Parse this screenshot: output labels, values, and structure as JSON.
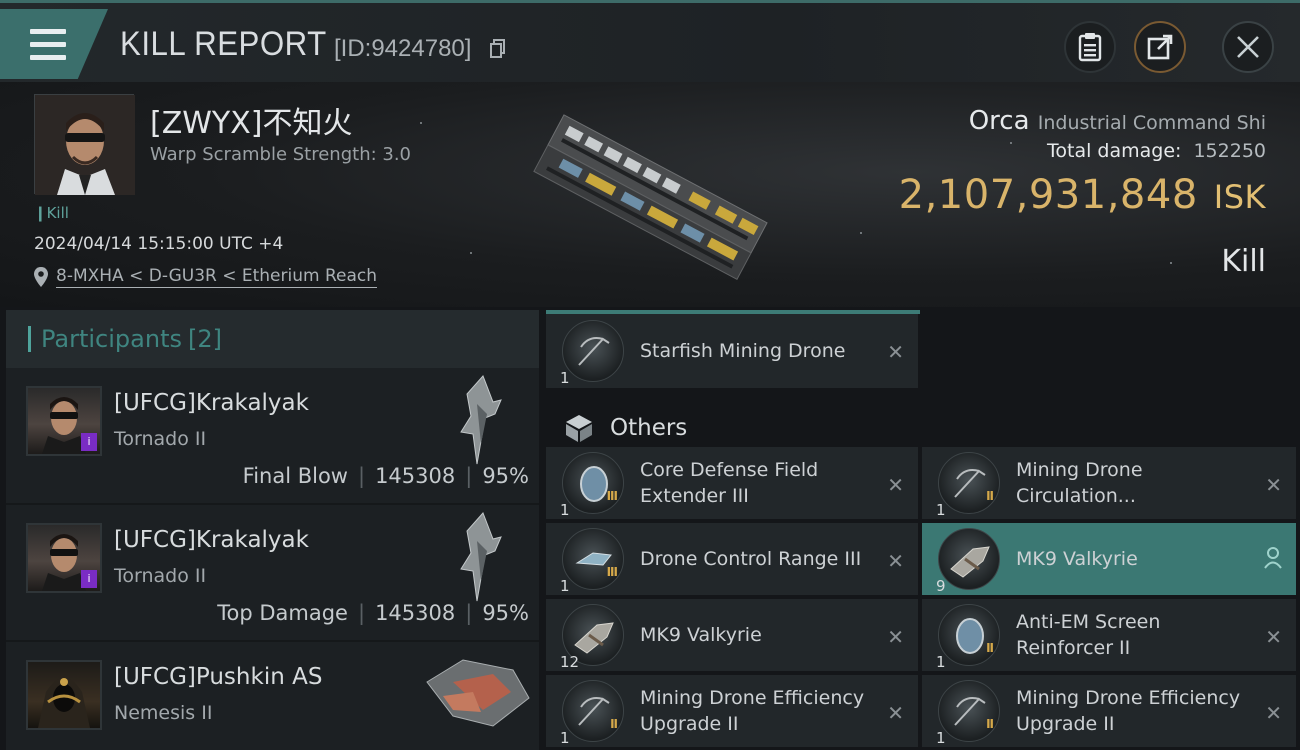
{
  "header": {
    "title": "KILL REPORT",
    "report_id": "[ID:9424780]",
    "buttons": {
      "notes": "clipboard-icon",
      "share": "external-link-icon",
      "close": "close-icon"
    }
  },
  "victim": {
    "name": "[ZWYX]不知火",
    "subtitle": "Warp Scramble Strength: 3.0",
    "kill_tag": "Kill",
    "datetime": "2024/04/14 15:15:00 UTC +4",
    "location": "8-MXHA < D-GU3R < Etherium Reach",
    "ship_name": "Orca",
    "ship_class": "Industrial Command Shi",
    "total_damage_label": "Total damage:",
    "total_damage": "152250",
    "isk_value": "2,107,931,848",
    "isk_unit": "ISK",
    "result": "Kill"
  },
  "participants": {
    "label": "Participants",
    "count": "[2]",
    "rows": [
      {
        "name": "[UFCG]Krakalyak",
        "ship": "Tornado II",
        "role": "Final Blow",
        "damage": "145308",
        "percent": "95%"
      },
      {
        "name": "[UFCG]Krakalyak",
        "ship": "Tornado II",
        "role": "Top Damage",
        "damage": "145308",
        "percent": "95%"
      },
      {
        "name": "[UFCG]Pushkin AS",
        "ship": "Nemesis II",
        "role": "",
        "damage": "",
        "percent": ""
      }
    ]
  },
  "items": {
    "drone_bay": [
      {
        "name": "Starfish Mining Drone",
        "qty": "1",
        "tier": ""
      }
    ],
    "others_label": "Others",
    "others": [
      {
        "name": "Core Defense Field Extender III",
        "qty": "1",
        "tier": "III",
        "dropped": false
      },
      {
        "name": "Mining Drone Circulation...",
        "qty": "1",
        "tier": "II",
        "dropped": false
      },
      {
        "name": "Drone Control Range III",
        "qty": "1",
        "tier": "III",
        "dropped": false
      },
      {
        "name": "MK9  Valkyrie",
        "qty": "9",
        "tier": "",
        "dropped": true
      },
      {
        "name": "MK9  Valkyrie",
        "qty": "12",
        "tier": "",
        "dropped": false
      },
      {
        "name": "Anti-EM Screen Reinforcer II",
        "qty": "1",
        "tier": "II",
        "dropped": false
      },
      {
        "name": "Mining Drone Efficiency Upgrade II",
        "qty": "1",
        "tier": "II",
        "dropped": false
      },
      {
        "name": "Mining Drone Efficiency Upgrade II",
        "qty": "1",
        "tier": "II",
        "dropped": false
      }
    ]
  },
  "colors": {
    "accent": "#3b6f6c",
    "isk": "#d9b46a",
    "dropped": "#3b7873",
    "corp_badge": "#7a2cc4"
  }
}
